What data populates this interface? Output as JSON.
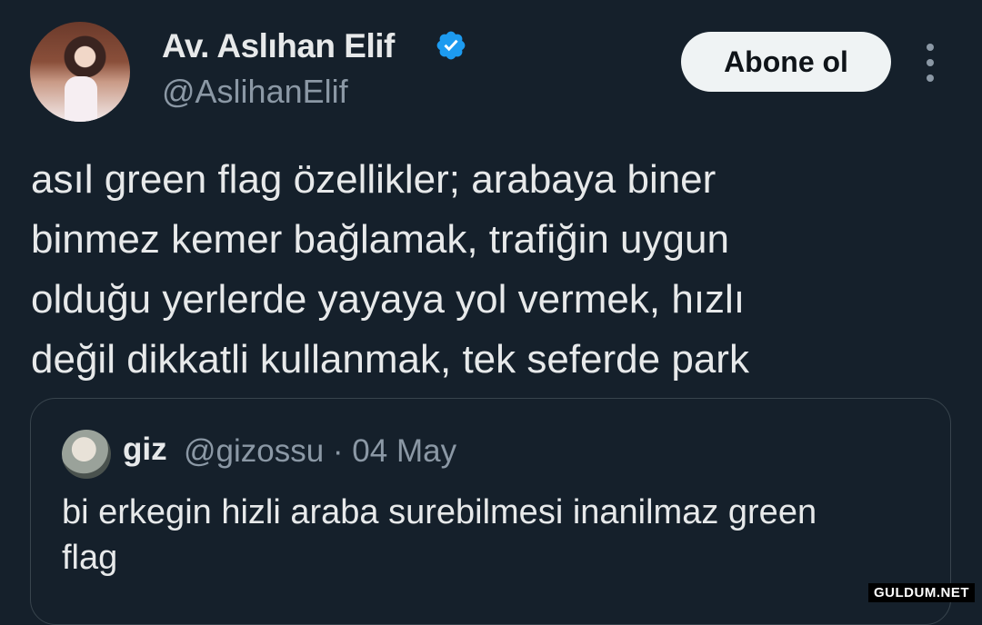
{
  "author": {
    "name": "Av. Aslıhan Elif",
    "handle": "@AslihanElif",
    "verified_color": "#1d9bf0"
  },
  "follow_button": {
    "label": "Abone ol"
  },
  "more_menu": {
    "icon": "vertical-ellipsis-icon"
  },
  "tweet": {
    "lines": [
      "asıl green flag özellikler; arabaya biner",
      "binmez kemer bağlamak, trafiğin uygun",
      "olduğu yerlerde yayaya yol vermek, hızlı",
      "değil dikkatli kullanmak, tek seferde park"
    ]
  },
  "quoted_tweet": {
    "name": "giz",
    "meta": "@gizossu · 04 May",
    "lines": [
      "bi erkegin hizli araba surebilmesi inanilmaz green",
      "flag"
    ]
  },
  "watermark": "GULDUM.NET",
  "colors": {
    "background": "#15202b",
    "text": "#e7e9ea",
    "secondary_text": "#8b98a5",
    "border": "#38444d",
    "button_bg": "#eff3f4"
  }
}
